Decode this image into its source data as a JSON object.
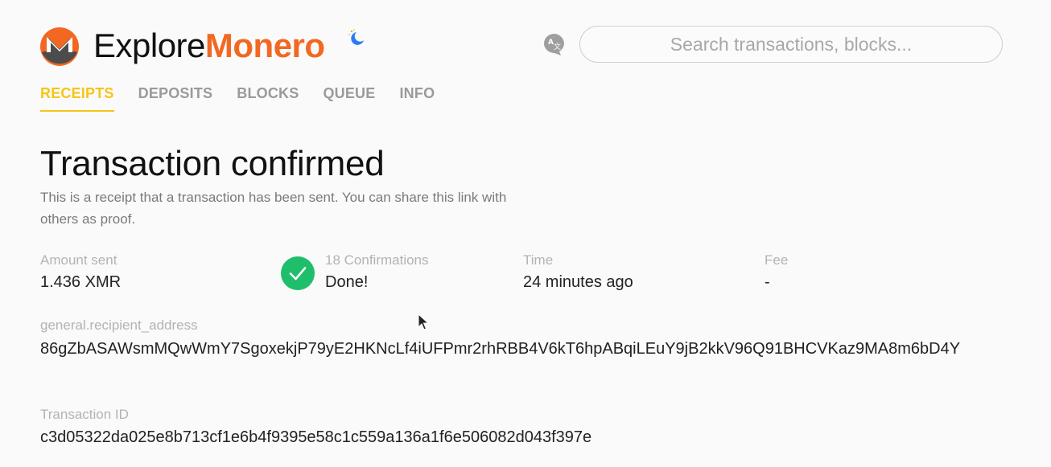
{
  "header": {
    "brand_part1": "Explore",
    "brand_part2": "Monero",
    "search_placeholder": "Search transactions, blocks...",
    "icons": {
      "logo": "monero-logo-icon",
      "theme": "moon-icon",
      "language": "translate-icon"
    }
  },
  "nav": {
    "tabs": [
      {
        "label": "RECEIPTS",
        "active": true
      },
      {
        "label": "DEPOSITS",
        "active": false
      },
      {
        "label": "BLOCKS",
        "active": false
      },
      {
        "label": "QUEUE",
        "active": false
      },
      {
        "label": "INFO",
        "active": false
      }
    ]
  },
  "main": {
    "title": "Transaction confirmed",
    "description": "This is a receipt that a transaction has been sent. You can share this link with others as proof.",
    "stats": {
      "amount": {
        "label": "Amount sent",
        "value": "1.436 XMR"
      },
      "confirmations": {
        "label": "18 Confirmations",
        "value": "Done!"
      },
      "time": {
        "label": "Time",
        "value": "24 minutes ago"
      },
      "fee": {
        "label": "Fee",
        "value": "-"
      }
    },
    "recipient": {
      "label": "general.recipient_address",
      "value": "86gZbASAWsmMQwWmY7SgoxekjP79yE2HKNcLf4iUFPmr2rhRBB4V6kT6hpABqiLEuY9jB2kkV96Q91BHCVKaz9MA8m6bD4Y"
    },
    "transaction": {
      "label": "Transaction ID",
      "value": "c3d05322da025e8b713cf1e6b4f9395e58c1c559a136a1f6e506082d043f397e"
    }
  },
  "colors": {
    "brand_orange": "#f26822",
    "active_tab": "#f5c518",
    "success_green": "#1fbe6b",
    "moon_blue": "#2a7bf6"
  }
}
